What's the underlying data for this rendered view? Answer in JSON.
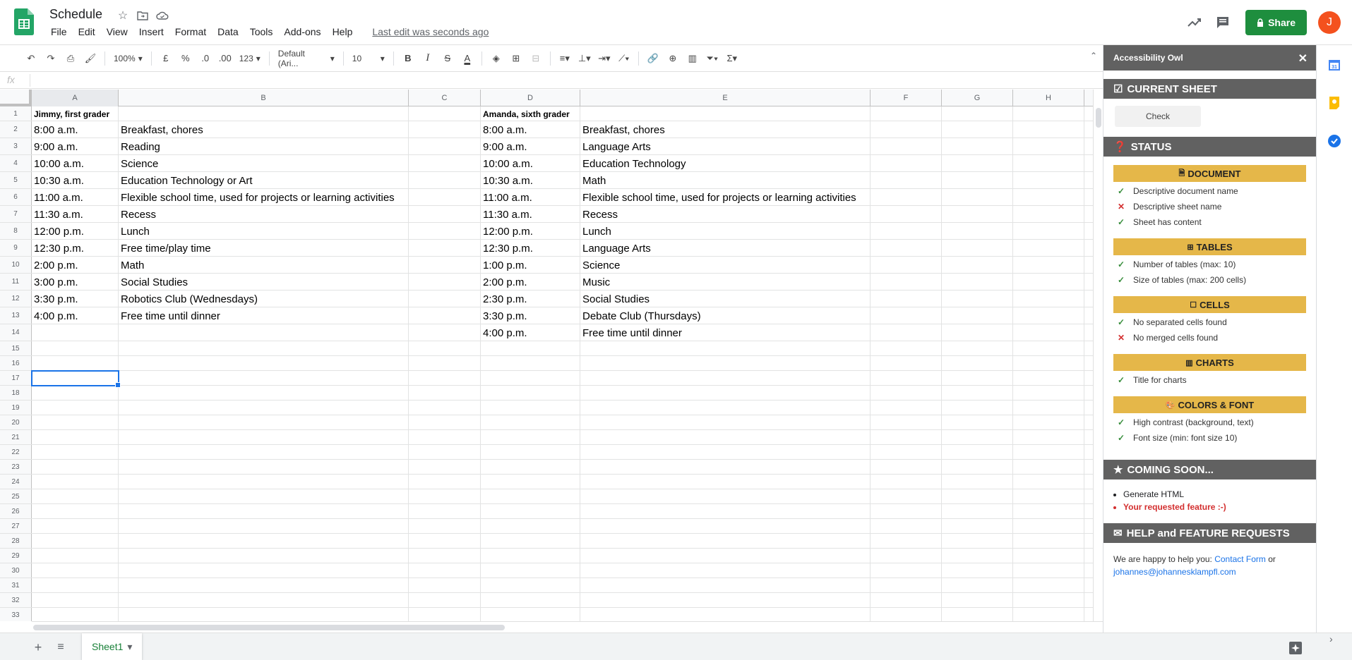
{
  "header": {
    "title": "Schedule",
    "menu": [
      "File",
      "Edit",
      "View",
      "Insert",
      "Format",
      "Data",
      "Tools",
      "Add-ons",
      "Help"
    ],
    "last_edit": "Last edit was seconds ago",
    "share_label": "Share",
    "avatar_initial": "J"
  },
  "toolbar": {
    "zoom": "100%",
    "currency": "£",
    "percent": "%",
    "dec_decrease": ".0",
    "dec_increase": ".00",
    "more_formats": "123",
    "font": "Default (Ari...",
    "font_size": "10",
    "icons": [
      "undo-icon",
      "redo-icon",
      "print-icon",
      "paint-format-icon",
      "bold-icon",
      "italic-icon",
      "strikethrough-icon",
      "text-color-icon",
      "fill-color-icon",
      "borders-icon",
      "merge-cells-icon",
      "horizontal-align-icon",
      "vertical-align-icon",
      "text-wrap-icon",
      "text-rotation-icon",
      "link-icon",
      "comment-icon",
      "chart-icon",
      "filter-icon",
      "functions-icon"
    ]
  },
  "formula_bar": {
    "fx": "fx",
    "value": ""
  },
  "grid": {
    "columns": [
      "A",
      "B",
      "C",
      "D",
      "E",
      "F",
      "G",
      "H"
    ],
    "row_numbers": [
      "1",
      "2",
      "3",
      "4",
      "5",
      "6",
      "7",
      "8",
      "9",
      "10",
      "11",
      "12",
      "13",
      "14",
      "15",
      "16",
      "17",
      "18",
      "19",
      "20",
      "21",
      "22",
      "23",
      "24",
      "25",
      "26",
      "27",
      "28",
      "29",
      "30",
      "31",
      "32",
      "33"
    ],
    "rows": [
      {
        "A": "Jimmy, first grader",
        "B": "",
        "D": "Amanda, sixth grader",
        "E": ""
      },
      {
        "A": "8:00 a.m.",
        "B": "Breakfast, chores",
        "D": "8:00 a.m.",
        "E": "Breakfast, chores"
      },
      {
        "A": "9:00 a.m.",
        "B": "Reading",
        "D": "9:00 a.m.",
        "E": "Language Arts"
      },
      {
        "A": "10:00 a.m.",
        "B": "Science",
        "D": "10:00 a.m.",
        "E": "Education Technology"
      },
      {
        "A": "10:30 a.m.",
        "B": "Education Technology or Art",
        "D": "10:30 a.m.",
        "E": "Math"
      },
      {
        "A": "11:00 a.m.",
        "B": "Flexible school time, used for projects or learning activities",
        "D": "11:00 a.m.",
        "E": "Flexible school time, used for projects or learning activities"
      },
      {
        "A": "11:30 a.m.",
        "B": "Recess",
        "D": "11:30 a.m.",
        "E": "Recess"
      },
      {
        "A": "12:00 p.m.",
        "B": "Lunch",
        "D": "12:00 p.m.",
        "E": "Lunch"
      },
      {
        "A": "12:30 p.m.",
        "B": "Free time/play time",
        "D": "12:30 p.m.",
        "E": "Language Arts"
      },
      {
        "A": "2:00 p.m.",
        "B": "Math",
        "D": "1:00 p.m.",
        "E": "Science"
      },
      {
        "A": "3:00 p.m.",
        "B": "Social Studies",
        "D": "2:00 p.m.",
        "E": "Music"
      },
      {
        "A": "3:30 p.m.",
        "B": "Robotics Club (Wednesdays)",
        "D": "2:30 p.m.",
        "E": "Social Studies"
      },
      {
        "A": "4:00 p.m.",
        "B": "Free time until dinner",
        "D": "3:30 p.m.",
        "E": "Debate Club (Thursdays)"
      },
      {
        "A": "",
        "B": "",
        "D": "4:00 p.m.",
        "E": "Free time until dinner"
      }
    ],
    "selected_cell": "A17"
  },
  "sheets": {
    "active": "Sheet1"
  },
  "addon": {
    "title": "Accessibility Owl",
    "current_sheet": "CURRENT SHEET",
    "check_label": "Check",
    "status": "STATUS",
    "categories": [
      {
        "name": "DOCUMENT",
        "icon": "document-icon",
        "items": [
          {
            "text": "Descriptive document name",
            "ok": true
          },
          {
            "text": "Descriptive sheet name",
            "ok": false
          },
          {
            "text": "Sheet has content",
            "ok": true
          }
        ]
      },
      {
        "name": "TABLES",
        "icon": "table-icon",
        "items": [
          {
            "text": "Number of tables (max: 10)",
            "ok": true
          },
          {
            "text": "Size of tables (max: 200 cells)",
            "ok": true
          }
        ]
      },
      {
        "name": "CELLS",
        "icon": "cell-icon",
        "items": [
          {
            "text": "No separated cells found",
            "ok": true
          },
          {
            "text": "No merged cells found",
            "ok": false
          }
        ]
      },
      {
        "name": "CHARTS",
        "icon": "chart-icon",
        "items": [
          {
            "text": "Title for charts",
            "ok": true
          }
        ]
      },
      {
        "name": "COLORS & FONT",
        "icon": "palette-icon",
        "items": [
          {
            "text": "High contrast (background, text)",
            "ok": true
          },
          {
            "text": "Font size (min: font size 10)",
            "ok": true
          }
        ]
      }
    ],
    "coming_soon": "COMING SOON...",
    "soon_items": [
      "Generate HTML",
      "Your requested feature :-)"
    ],
    "help_title": "HELP and FEATURE REQUESTS",
    "help_text": "We are happy to help you:",
    "contact_link": "Contact Form",
    "or": "or",
    "email": "johannes@johannesklampfl.com"
  },
  "colors": {
    "share_green": "#1e8e3e",
    "avatar": "#f4511e",
    "panel_header": "#616161",
    "category_gold": "#e5b749",
    "ok_green": "#388e3c",
    "fail_red": "#d32f2f"
  }
}
